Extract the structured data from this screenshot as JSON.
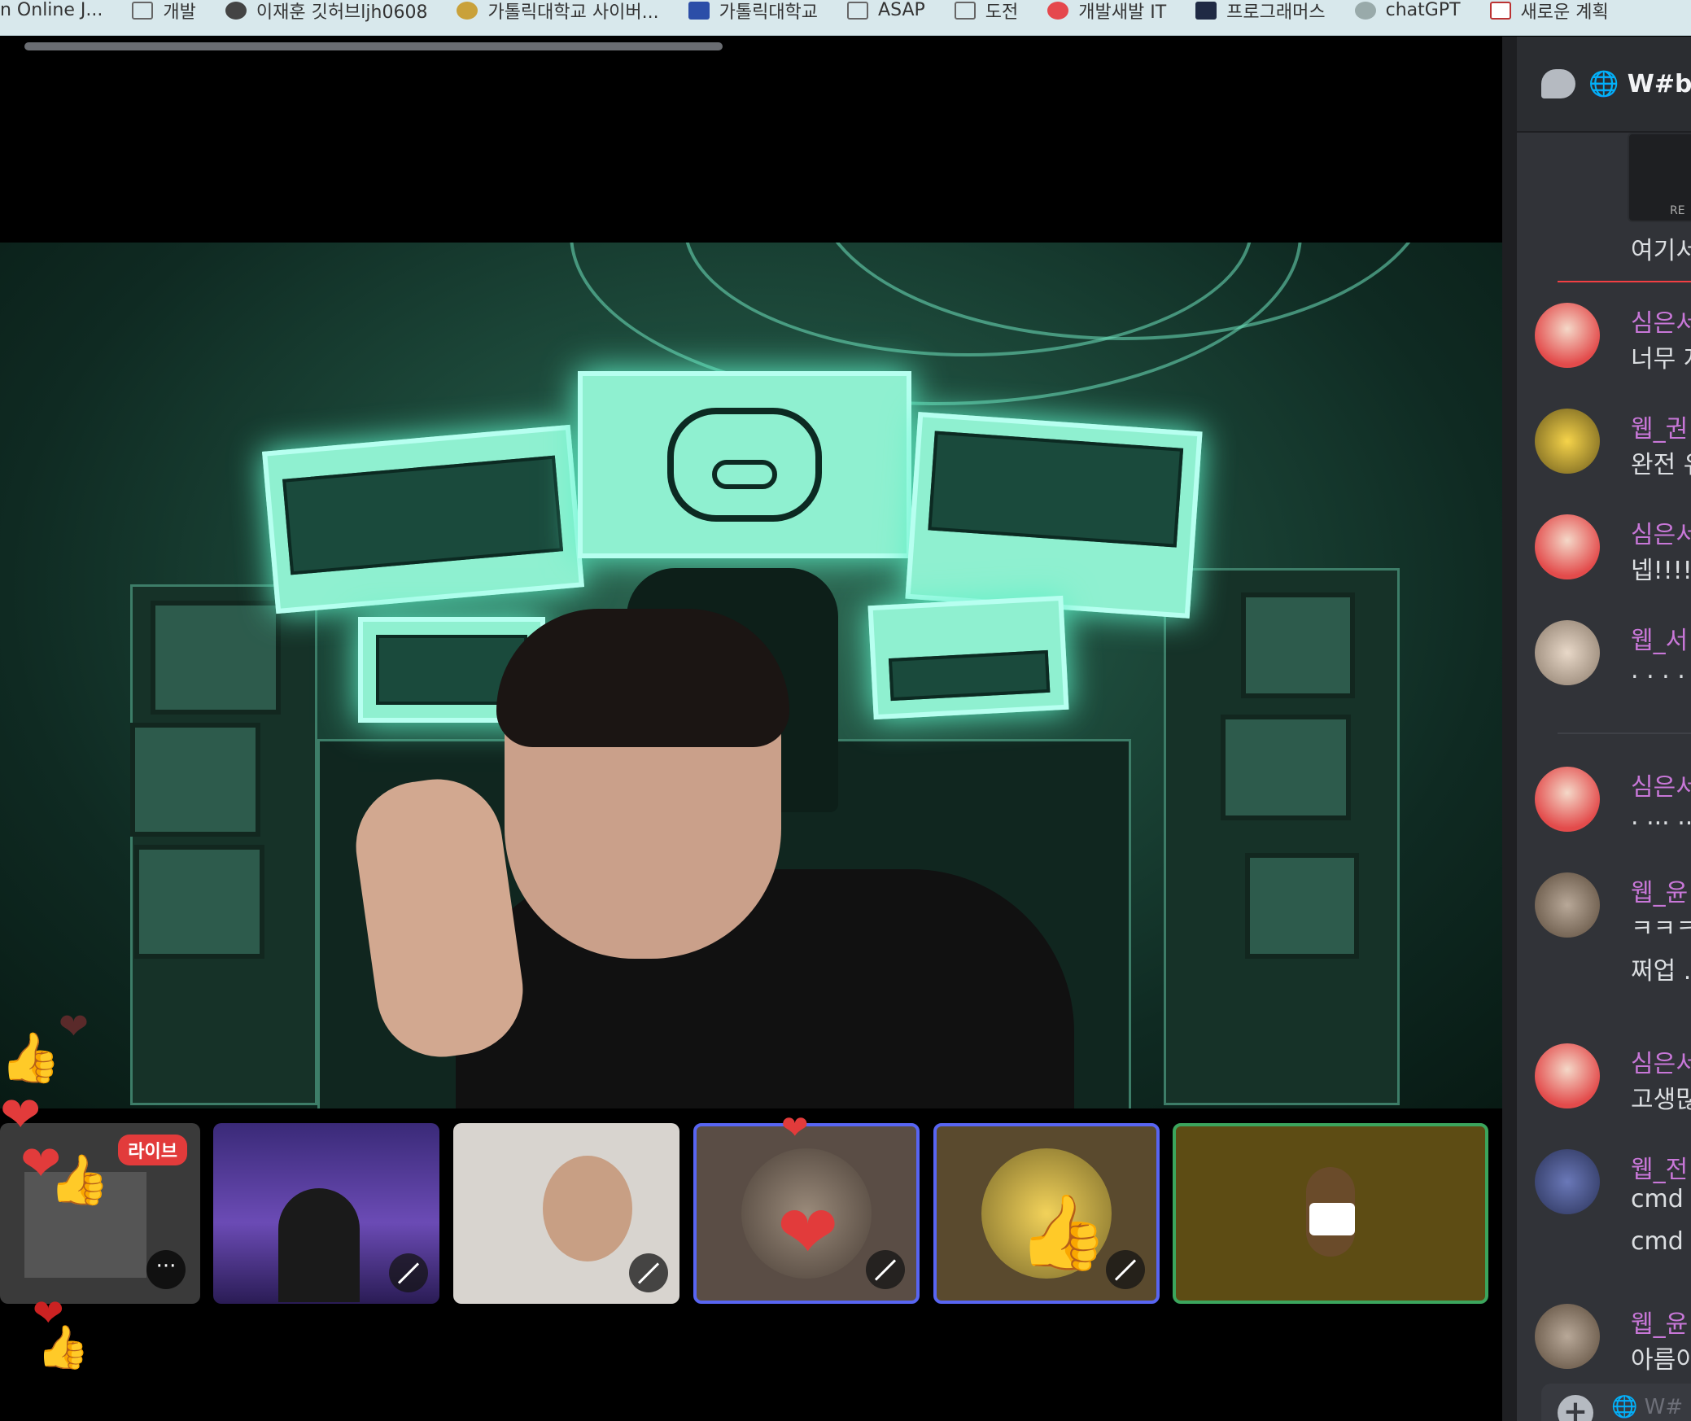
{
  "bookmarks": [
    {
      "label": "n Online J...",
      "icon": "globe-icon"
    },
    {
      "label": "개발",
      "icon": "folder-icon"
    },
    {
      "label": "이재훈 깃허브ljh0608",
      "icon": "github-icon"
    },
    {
      "label": "가톨릭대학교 사이버...",
      "icon": "university-icon"
    },
    {
      "label": "가톨릭대학교",
      "icon": "university-icon"
    },
    {
      "label": "ASAP",
      "icon": "folder-icon"
    },
    {
      "label": "도전",
      "icon": "folder-icon"
    },
    {
      "label": "개발새발 IT",
      "icon": "red-dot-icon"
    },
    {
      "label": "프로그래머스",
      "icon": "programmers-icon"
    },
    {
      "label": "chatGPT",
      "icon": "openai-icon"
    },
    {
      "label": "새로운 계획",
      "icon": "calendar-icon"
    }
  ],
  "tiles": {
    "screen_share": {
      "badge": "라이브",
      "more": "···"
    },
    "mute_glyph": "🎙"
  },
  "reactions": {
    "heart": "❤",
    "thumbs": "👍"
  },
  "chat": {
    "header_title": "🌐 W#b |",
    "embed_text": "RE",
    "pinned_text": "여기서",
    "messages": [
      {
        "name": "심은서",
        "lines": [
          "너무 지"
        ],
        "avatar": "shinchan"
      },
      {
        "name": "웹_권",
        "lines": [
          "완전 유"
        ],
        "avatar": "chick"
      },
      {
        "name": "심은서",
        "lines": [
          "넵!!!!"
        ],
        "avatar": "shinchan"
      },
      {
        "name": "웹_서",
        "lines": [
          ". . . . ."
        ],
        "avatar": "puppy"
      },
      {
        "name": "심은서",
        "lines": [
          ". ... ..."
        ],
        "avatar": "shinchan"
      },
      {
        "name": "웹_윤",
        "lines": [
          "ㅋㅋㅋ",
          "쩌업 ."
        ],
        "avatar": "cat"
      },
      {
        "name": "심은서",
        "lines": [
          "고생많"
        ],
        "avatar": "shinchan"
      },
      {
        "name": "웹_전",
        "lines": [
          "cmd s",
          "cmd s"
        ],
        "avatar": "stitch"
      },
      {
        "name": "웹_윤",
        "lines": [
          "아름이"
        ],
        "avatar": "cat"
      }
    ],
    "input_placeholder": "🌐 W#"
  },
  "colors": {
    "chat_bg": "#313338",
    "name_color": "#c877d8",
    "speaking_border": "#5865f2",
    "active_border": "#3ba55d"
  }
}
